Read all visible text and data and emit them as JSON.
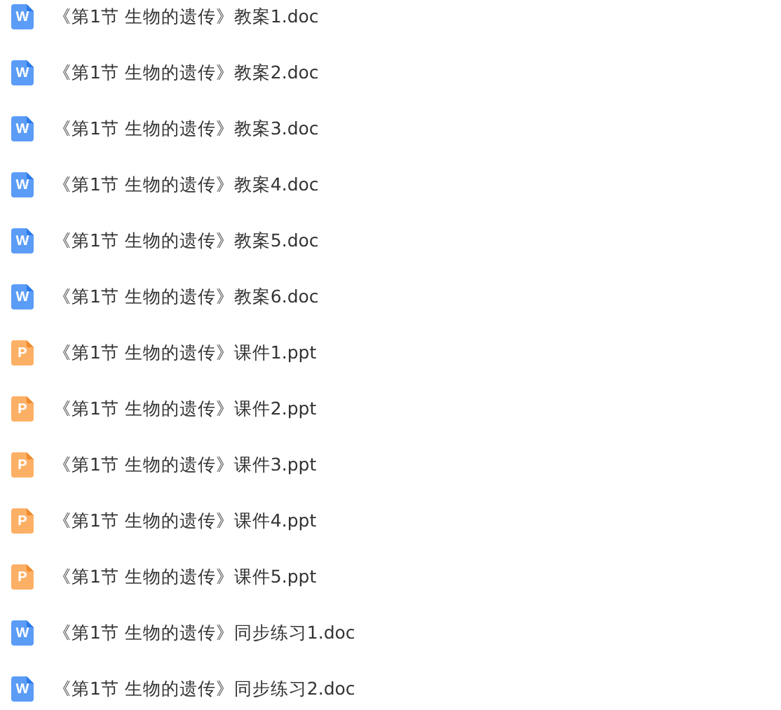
{
  "files": [
    {
      "kind": "doc",
      "icon_letter": "W",
      "name": "《第1节 生物的遗传》教案1.doc"
    },
    {
      "kind": "doc",
      "icon_letter": "W",
      "name": "《第1节 生物的遗传》教案2.doc"
    },
    {
      "kind": "doc",
      "icon_letter": "W",
      "name": "《第1节 生物的遗传》教案3.doc"
    },
    {
      "kind": "doc",
      "icon_letter": "W",
      "name": "《第1节 生物的遗传》教案4.doc"
    },
    {
      "kind": "doc",
      "icon_letter": "W",
      "name": "《第1节 生物的遗传》教案5.doc"
    },
    {
      "kind": "doc",
      "icon_letter": "W",
      "name": "《第1节 生物的遗传》教案6.doc"
    },
    {
      "kind": "ppt",
      "icon_letter": "P",
      "name": "《第1节 生物的遗传》课件1.ppt"
    },
    {
      "kind": "ppt",
      "icon_letter": "P",
      "name": "《第1节 生物的遗传》课件2.ppt"
    },
    {
      "kind": "ppt",
      "icon_letter": "P",
      "name": "《第1节 生物的遗传》课件3.ppt"
    },
    {
      "kind": "ppt",
      "icon_letter": "P",
      "name": "《第1节 生物的遗传》课件4.ppt"
    },
    {
      "kind": "ppt",
      "icon_letter": "P",
      "name": "《第1节 生物的遗传》课件5.ppt"
    },
    {
      "kind": "doc",
      "icon_letter": "W",
      "name": "《第1节 生物的遗传》同步练习1.doc"
    },
    {
      "kind": "doc",
      "icon_letter": "W",
      "name": "《第1节 生物的遗传》同步练习2.doc"
    }
  ]
}
